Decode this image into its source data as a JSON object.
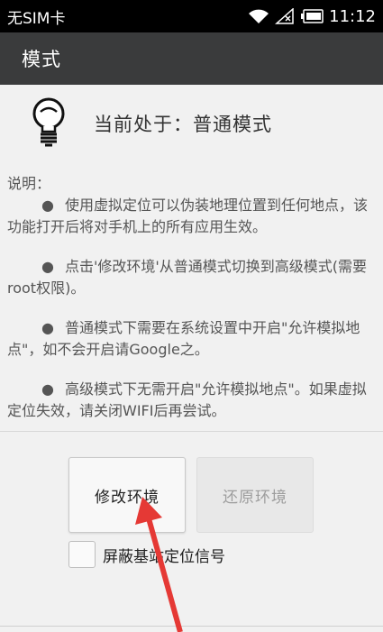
{
  "status_bar": {
    "carrier": "无SIM卡",
    "time": "11:12",
    "icons": [
      "wifi-icon",
      "no-signal-icon",
      "battery-icon"
    ]
  },
  "app_bar": {
    "title": "模式"
  },
  "mode": {
    "label": "当前处于：普通模式",
    "icon": "lightbulb-icon"
  },
  "description": {
    "heading": "说明：",
    "bullet": "●",
    "items": [
      "使用虚拟定位可以伪装地理位置到任何地点，该功能打开后将对手机上的所有应用生效。",
      "点击'修改环境'从普通模式切换到高级模式(需要root权限)。",
      "普通模式下需要在系统设置中开启\"允许模拟地点\"，如不会开启请Google之。",
      "高级模式下无需开启\"允许模拟地点\"。如果虚拟定位失效，请关闭WIFI后再尝试。"
    ]
  },
  "buttons": {
    "modify": "修改环境",
    "restore": "还原环境"
  },
  "checkbox": {
    "label": "屏蔽基站定位信号",
    "checked": false
  },
  "colors": {
    "app_bar": "#3a3b3c",
    "status_bar": "#000000",
    "background": "#f1f1f1",
    "annotation_arrow": "#e53935"
  }
}
